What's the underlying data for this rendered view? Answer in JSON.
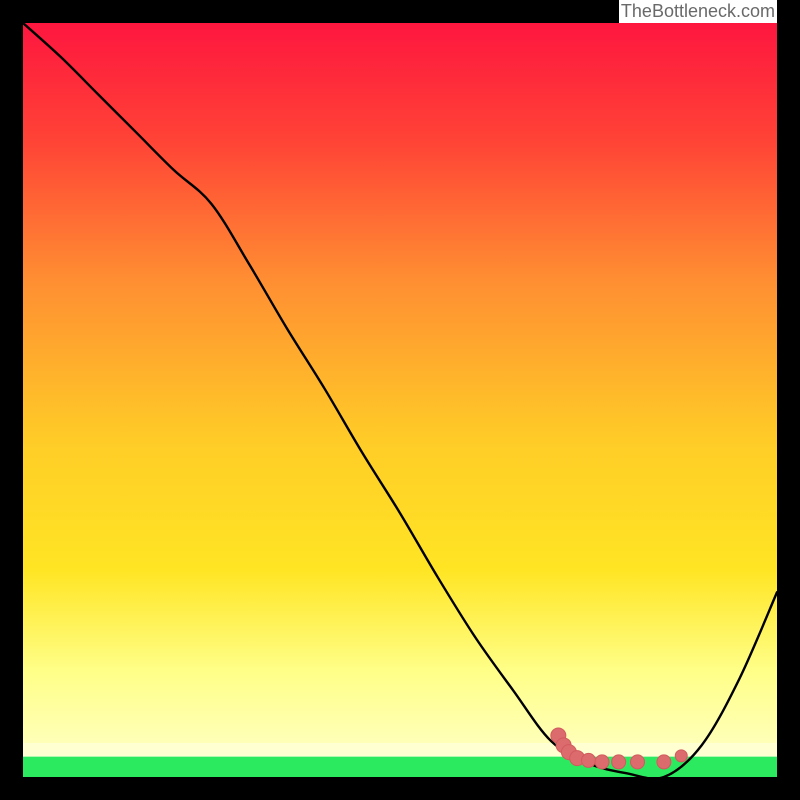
{
  "watermark": "TheBottleneck.com",
  "colors": {
    "border": "#000000",
    "grad_top": "#FE163F",
    "grad_mid_upper": "#FF8F32",
    "grad_mid": "#FFE524",
    "grad_lower": "#FFFF88",
    "grad_band_yellow": "#FFFFB8",
    "grad_band_green": "#2BEA5F",
    "curve": "#000000",
    "marker_fill": "#DC6B6E",
    "marker_stroke": "#D25A5D"
  },
  "chart_data": {
    "type": "line",
    "x": [
      0.0,
      0.05,
      0.1,
      0.15,
      0.2,
      0.25,
      0.3,
      0.35,
      0.4,
      0.45,
      0.5,
      0.55,
      0.6,
      0.65,
      0.7,
      0.75,
      0.8,
      0.85,
      0.9,
      0.95,
      1.0
    ],
    "values": [
      1.0,
      0.955,
      0.905,
      0.855,
      0.805,
      0.76,
      0.68,
      0.595,
      0.515,
      0.43,
      0.35,
      0.265,
      0.185,
      0.115,
      0.048,
      0.018,
      0.005,
      0.0,
      0.042,
      0.13,
      0.245
    ],
    "title": "",
    "xlabel": "",
    "ylabel": "",
    "xlim": [
      0,
      1
    ],
    "ylim": [
      0,
      1
    ],
    "highlight_points": [
      {
        "x": 0.71,
        "y": 0.055
      },
      {
        "x": 0.717,
        "y": 0.042
      },
      {
        "x": 0.724,
        "y": 0.033
      },
      {
        "x": 0.735,
        "y": 0.025
      },
      {
        "x": 0.75,
        "y": 0.022
      },
      {
        "x": 0.768,
        "y": 0.02
      },
      {
        "x": 0.79,
        "y": 0.02
      },
      {
        "x": 0.815,
        "y": 0.02
      },
      {
        "x": 0.85,
        "y": 0.02
      }
    ]
  }
}
